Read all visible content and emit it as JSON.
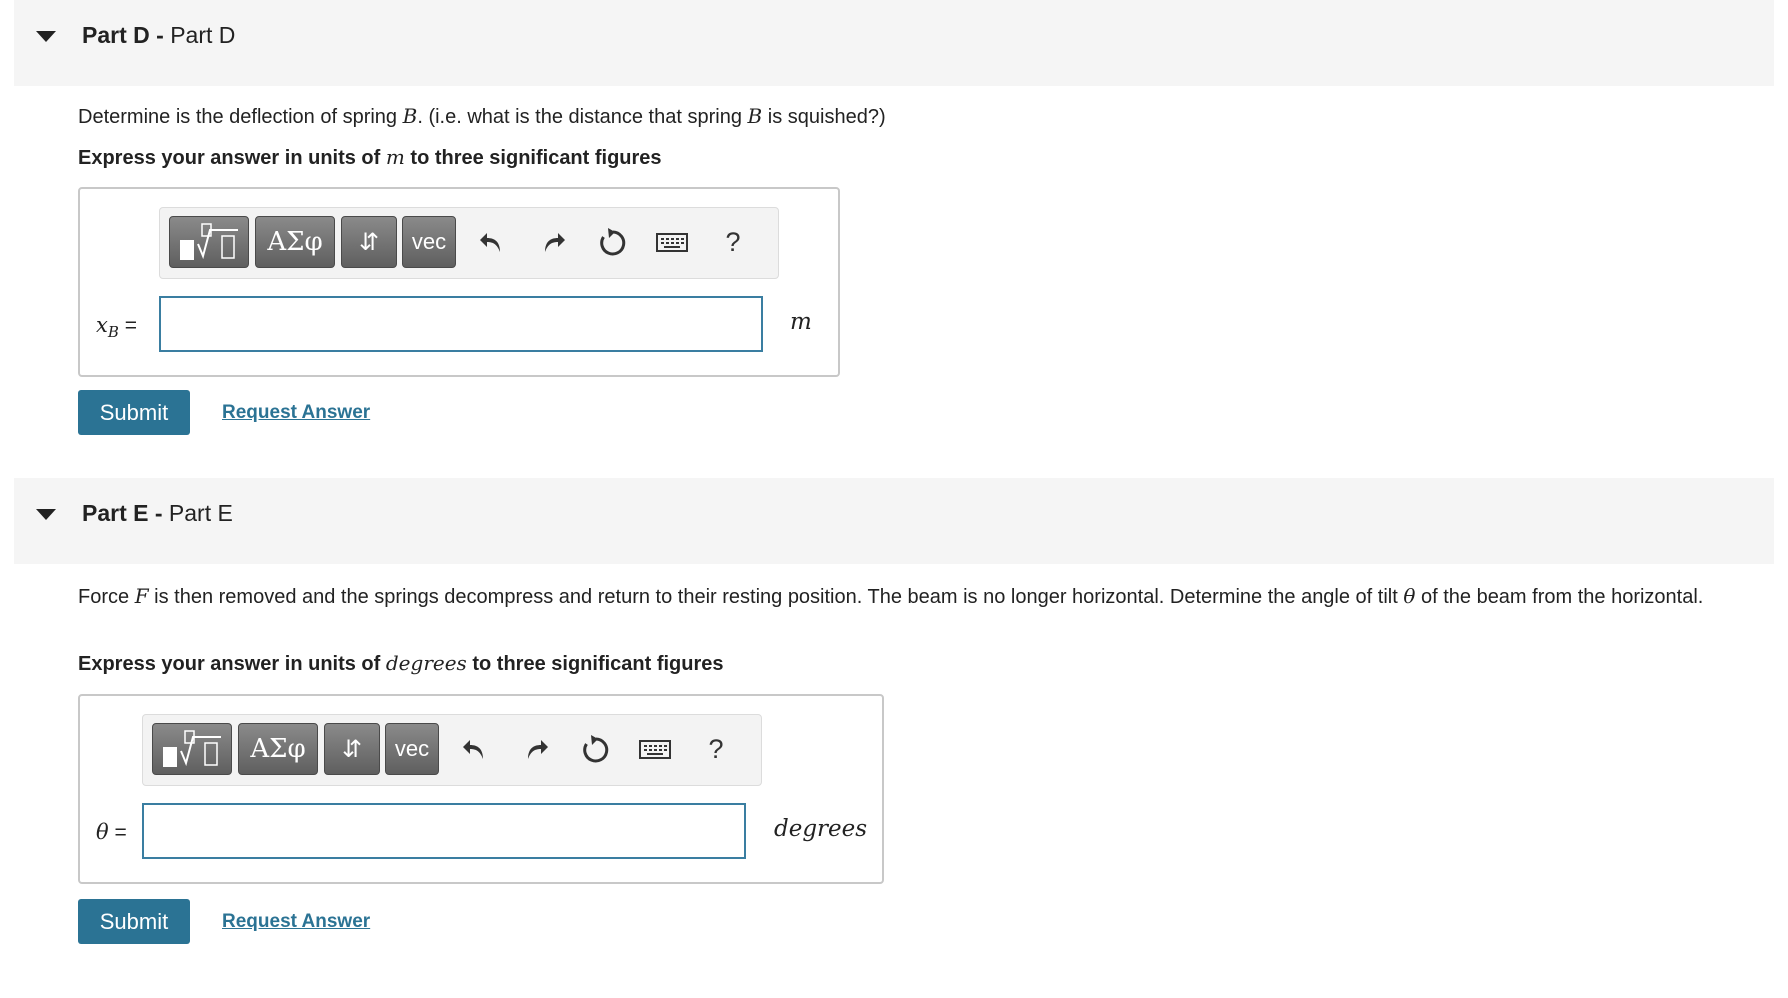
{
  "partD": {
    "title_bold": "Part D -",
    "title_rest": "Part D",
    "prompt_a": "Determine is the deflection of spring",
    "prompt_var1": "B",
    "prompt_b": ". (i.e. what is the distance that spring",
    "prompt_var2": "B",
    "prompt_c": "is squished?)",
    "instr_a": "Express your answer in units of",
    "instr_unit": "m",
    "instr_b": "to three significant figures",
    "var_main": "x",
    "var_sub": "B",
    "var_eq": " =",
    "input_value": "",
    "unit": "m",
    "submit_label": "Submit",
    "request_label": "Request Answer"
  },
  "partE": {
    "title_bold": "Part E -",
    "title_rest": "Part E",
    "prompt_a": "Force",
    "prompt_var1": "F",
    "prompt_b": "is then removed and the springs decompress and return to their resting position. The beam is no longer horizontal. Determine the angle of tilt",
    "prompt_var2": "θ",
    "prompt_c": "of the beam from the horizontal.",
    "instr_a": "Express your answer in units of",
    "instr_unit": "degrees",
    "instr_b": "to three significant figures",
    "var_main": "θ",
    "var_eq": " =",
    "input_value": "",
    "unit": "degrees",
    "submit_label": "Submit",
    "request_label": "Request Answer"
  },
  "toolbar": {
    "templates_icon": "templates-icon",
    "greek_label": "ΑΣφ",
    "arrows_label": "⇵",
    "vec_label": "vec",
    "undo_icon": "undo-icon",
    "redo_icon": "redo-icon",
    "reset_icon": "reset-icon",
    "keyboard_icon": "keyboard-icon",
    "help_label": "?"
  },
  "colors": {
    "accent": "#2b7394",
    "header_bg": "#f5f5f5",
    "button_dark": "#6e6e6e"
  }
}
